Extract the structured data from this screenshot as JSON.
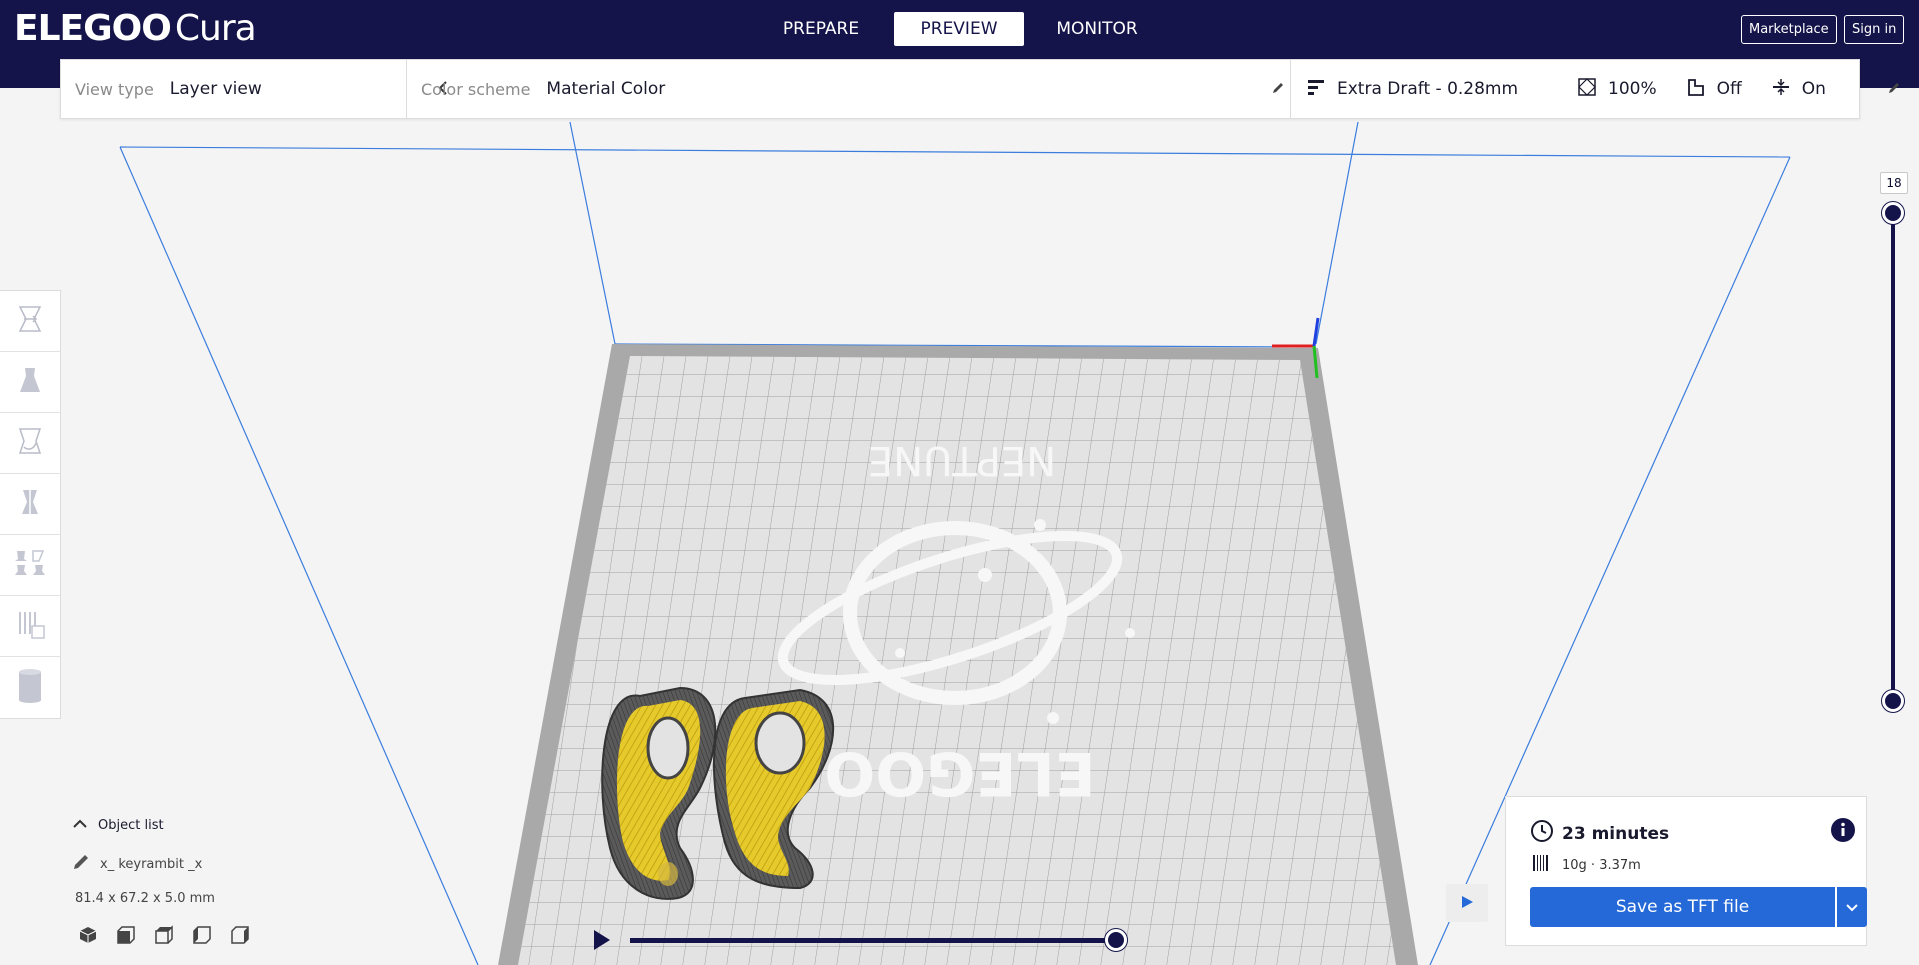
{
  "header": {
    "logo_main": "ELEGOO",
    "logo_sub": "Cura",
    "tabs": [
      {
        "label": "PREPARE"
      },
      {
        "label": "PREVIEW"
      },
      {
        "label": "MONITOR"
      }
    ],
    "active_tab": "PREVIEW",
    "marketplace_label": "Marketplace",
    "signin_label": "Sign in"
  },
  "toolbar": {
    "view_type_label": "View type",
    "view_type_value": "Layer view",
    "color_scheme_label": "Color scheme",
    "color_scheme_value": "Material Color",
    "profile": "Extra Draft - 0.28mm",
    "infill": "100%",
    "support": "Off",
    "adhesion": "On"
  },
  "layer_slider": {
    "current_layer": "18"
  },
  "object_panel": {
    "header_label": "Object list",
    "object_name": "x_ keyrambit _x",
    "dimensions": "81.4 x 67.2 x 5.0 mm"
  },
  "bed": {
    "brand_top": "NEPTUNE",
    "brand_bottom": "ELEGOO"
  },
  "print_info": {
    "time": "23 minutes",
    "material": "10g · 3.37m",
    "save_label": "Save as TFT file"
  },
  "colors": {
    "header_bg": "#14144a",
    "accent_blue": "#2469d7",
    "model_yellow": "#e6c92a",
    "model_wall": "#555555",
    "build_volume_line": "#3b7ddd"
  },
  "icons": {
    "tools": [
      "translate-icon",
      "scale-icon",
      "rotate-icon",
      "mirror-icon",
      "per-model-settings-icon",
      "support-blocker-icon",
      "cylinder-icon"
    ],
    "view_buttons": [
      "3d-view-icon",
      "front-view-icon",
      "top-view-icon",
      "left-view-icon",
      "right-view-icon"
    ]
  }
}
